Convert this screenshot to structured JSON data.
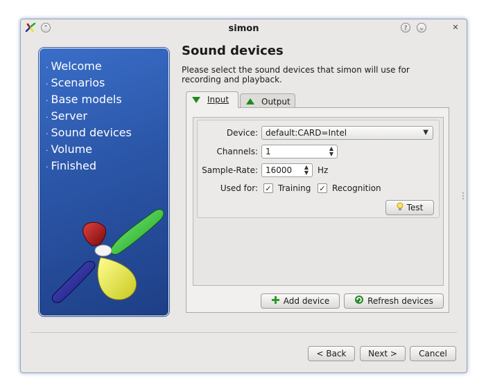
{
  "window": {
    "title": "simon",
    "controls": {
      "help": "?",
      "minimize": "⌄",
      "close": "✕",
      "shade": "⌃"
    }
  },
  "sidebar": {
    "steps": [
      "Welcome",
      "Scenarios",
      "Base models",
      "Server",
      "Sound devices",
      "Volume",
      "Finished"
    ],
    "bullet": "·"
  },
  "page": {
    "heading": "Sound devices",
    "description": "Please select the sound devices that simon will use for recording and playback."
  },
  "tabs": [
    {
      "label": "Input",
      "active": true
    },
    {
      "label": "Output",
      "active": false
    }
  ],
  "device_form": {
    "device_label": "Device:",
    "device_value": "default:CARD=Intel",
    "channels_label": "Channels:",
    "channels_value": "1",
    "samplerate_label": "Sample-Rate:",
    "samplerate_value": "16000",
    "samplerate_unit": "Hz",
    "usedfor_label": "Used for:",
    "training_label": "Training",
    "training_checked": true,
    "recognition_label": "Recognition",
    "recognition_checked": true,
    "test_button": "Test"
  },
  "actions": {
    "add_device": "Add device",
    "refresh_devices": "Refresh devices"
  },
  "footer": {
    "back": "< Back",
    "next": "Next >",
    "cancel": "Cancel"
  },
  "colors": {
    "sidebar_top": "#3a6ec8",
    "sidebar_bottom": "#1e3f86",
    "tab_arrow": "#1d8a1d",
    "window_bg": "#e9e8e6"
  }
}
